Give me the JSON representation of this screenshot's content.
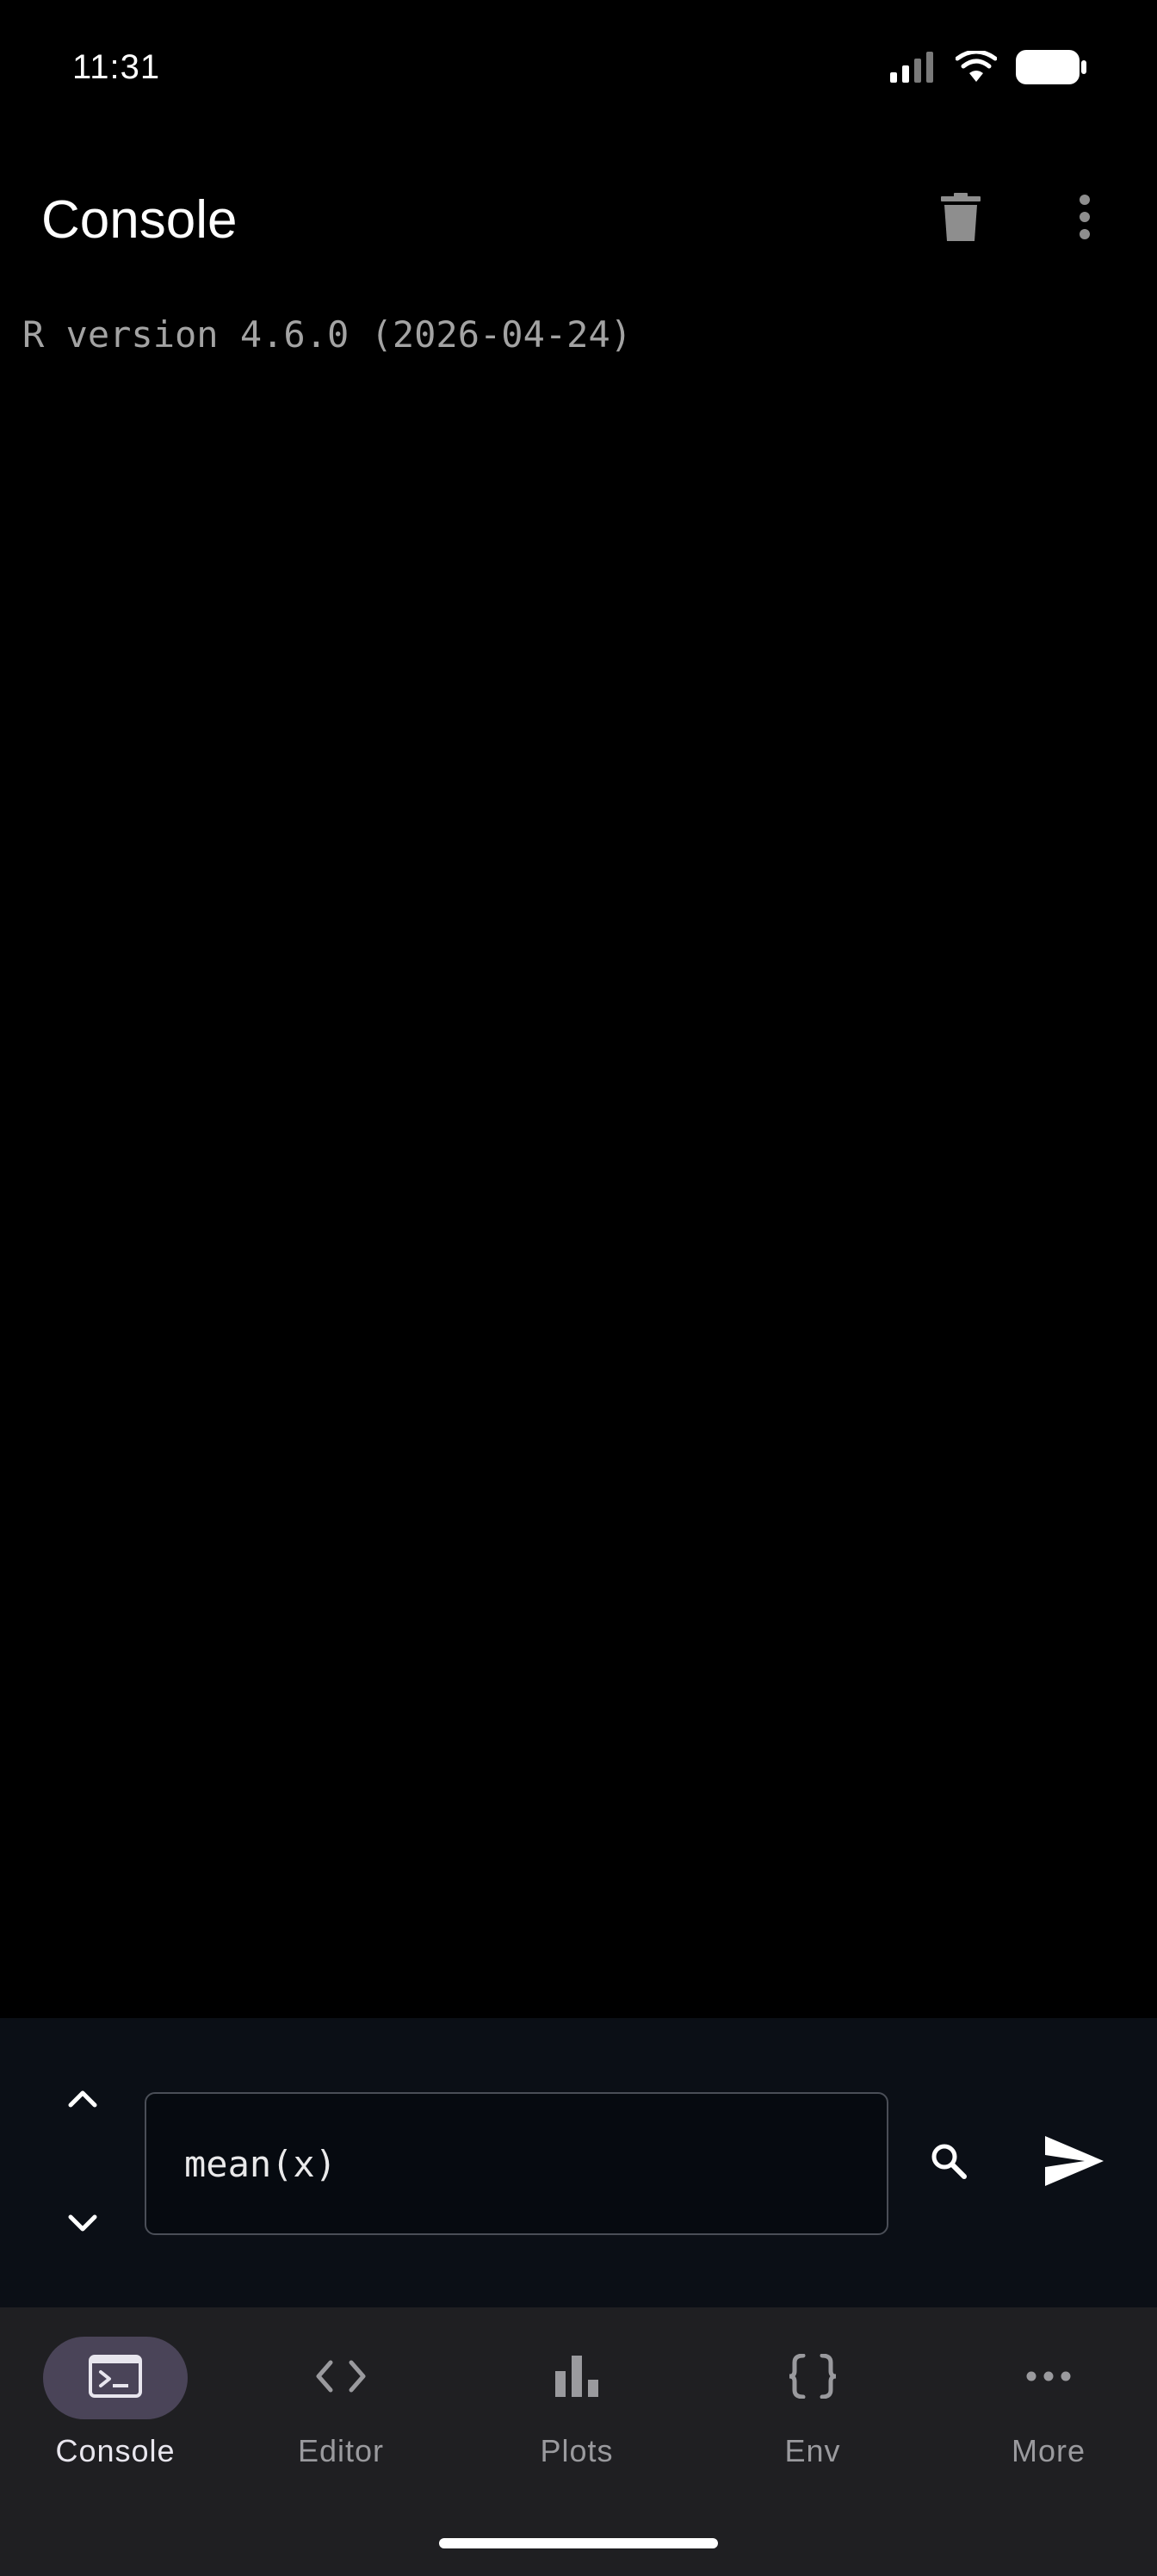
{
  "status_bar": {
    "time": "11:31",
    "icons": [
      "signal-icon",
      "wifi-icon",
      "battery-icon"
    ]
  },
  "app_bar": {
    "title": "Console",
    "actions": [
      "delete-icon",
      "more-vert-icon"
    ]
  },
  "console": {
    "output_lines": [
      "R version 4.6.0 (2026-04-24)"
    ]
  },
  "input": {
    "value": "mean(x)",
    "history_up_icon": "chevron-up-icon",
    "history_down_icon": "chevron-down-icon",
    "search_icon": "search-icon",
    "send_icon": "send-icon"
  },
  "bottom_nav": {
    "items": [
      {
        "label": "Console",
        "icon": "terminal-icon",
        "active": true
      },
      {
        "label": "Editor",
        "icon": "code-icon",
        "active": false
      },
      {
        "label": "Plots",
        "icon": "bar-chart-icon",
        "active": false
      },
      {
        "label": "Env",
        "icon": "braces-icon",
        "active": false
      },
      {
        "label": "More",
        "icon": "more-horiz-icon",
        "active": false
      }
    ]
  },
  "colors": {
    "background": "#000000",
    "input_panel": "#0b0f16",
    "nav_background": "#1f1f22",
    "active_pill": "#4a4458",
    "console_text": "#a3a3a3"
  }
}
